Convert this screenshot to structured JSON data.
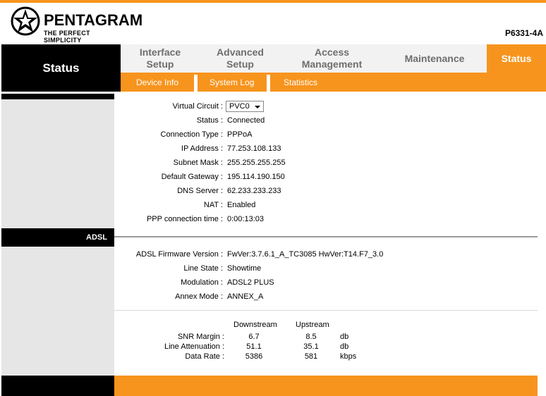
{
  "brand": {
    "name": "PENTAGRAM",
    "tagline": "THE PERFECT SIMPLICITY",
    "model": "P6331-4A"
  },
  "side_title": "Status",
  "nav": [
    {
      "label_1": "Interface",
      "label_2": "Setup"
    },
    {
      "label_1": "Advanced",
      "label_2": "Setup"
    },
    {
      "label_1": "Access",
      "label_2": "Management"
    },
    {
      "label_1": "Maintenance",
      "label_2": ""
    },
    {
      "label_1": "Status",
      "label_2": ""
    }
  ],
  "subnav": [
    "Device Info",
    "System Log",
    "Statistics"
  ],
  "wan": {
    "virtual_circuit_label": "Virtual Circuit :",
    "virtual_circuit_value": "PVC0",
    "rows": [
      {
        "label": "Status :",
        "value": "Connected"
      },
      {
        "label": "Connection Type :",
        "value": "PPPoA"
      },
      {
        "label": "IP Address :",
        "value": "77.253.108.133"
      },
      {
        "label": "Subnet Mask :",
        "value": "255.255.255.255"
      },
      {
        "label": "Default Gateway :",
        "value": "195.114.190.150"
      },
      {
        "label": "DNS Server :",
        "value": "62.233.233.233"
      },
      {
        "label": "NAT :",
        "value": "Enabled"
      },
      {
        "label": "PPP connection time :",
        "value": "0:00:13:03"
      }
    ]
  },
  "adsl": {
    "section_label": "ADSL",
    "rows": [
      {
        "label": "ADSL Firmware Version :",
        "value": "FwVer:3.7.6.1_A_TC3085 HwVer:T14.F7_3.0"
      },
      {
        "label": "Line State :",
        "value": "Showtime"
      },
      {
        "label": "Modulation :",
        "value": "ADSL2 PLUS"
      },
      {
        "label": "Annex Mode :",
        "value": "ANNEX_A"
      }
    ],
    "stats_headers": {
      "down": "Downstream",
      "up": "Upstream"
    },
    "stats": [
      {
        "label": "SNR Margin :",
        "down": "6.7",
        "up": "8.5",
        "unit": "db"
      },
      {
        "label": "Line Attenuation :",
        "down": "51.1",
        "up": "35.1",
        "unit": "db"
      },
      {
        "label": "Data Rate :",
        "down": "5386",
        "up": "581",
        "unit": "kbps"
      }
    ]
  },
  "colors": {
    "accent": "#f7941d",
    "black": "#000000",
    "side_gray": "#e6e6e6"
  }
}
